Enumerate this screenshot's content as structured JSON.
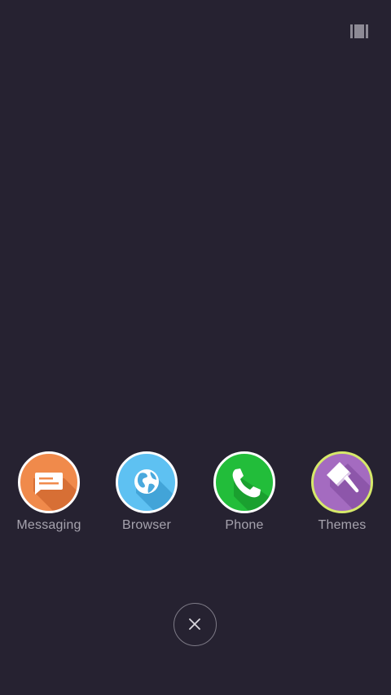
{
  "top_bar": {
    "icon": "layout-bars-icon"
  },
  "dock": {
    "apps": [
      {
        "label": "Messaging",
        "icon": "message-icon",
        "color": "#f08a4b"
      },
      {
        "label": "Browser",
        "icon": "globe-icon",
        "color": "#5ec1f2"
      },
      {
        "label": "Phone",
        "icon": "phone-icon",
        "color": "#22bd3a"
      },
      {
        "label": "Themes",
        "icon": "paintbrush-icon",
        "color": "#a46bc0",
        "ring_color": "#d6e96a"
      }
    ]
  },
  "close_button": {
    "icon": "close-icon"
  }
}
